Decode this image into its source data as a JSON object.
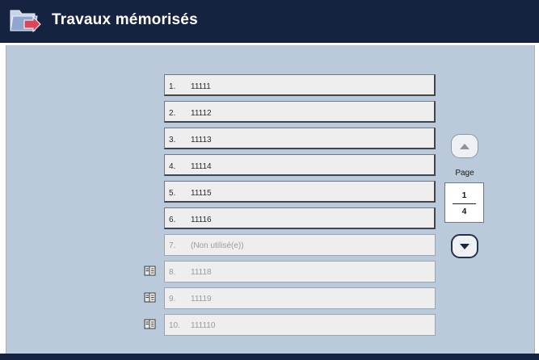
{
  "header": {
    "title": "Travaux mémorisés",
    "icon": "folder-arrow-icon"
  },
  "colors": {
    "header_bg": "#162340",
    "panel_bg": "#bacadb",
    "row_bg": "#eeeeee"
  },
  "jobs": [
    {
      "num": "1.",
      "name": "11111",
      "state": "active"
    },
    {
      "num": "2.",
      "name": "11112",
      "state": "active"
    },
    {
      "num": "3.",
      "name": "11113",
      "state": "active"
    },
    {
      "num": "4.",
      "name": "11114",
      "state": "active"
    },
    {
      "num": "5.",
      "name": "11115",
      "state": "active"
    },
    {
      "num": "6.",
      "name": "11116",
      "state": "active"
    },
    {
      "num": "7.",
      "name": "(Non utilisé(e))",
      "state": "unused"
    },
    {
      "num": "8.",
      "name": "11118",
      "state": "disabled",
      "icon": "document-icon"
    },
    {
      "num": "9.",
      "name": "11119",
      "state": "disabled",
      "icon": "document-icon"
    },
    {
      "num": "10.",
      "name": "111110",
      "state": "disabled",
      "icon": "document-icon"
    }
  ],
  "pagination": {
    "label": "Page",
    "current": "1",
    "total": "4",
    "up_icon": "arrow-up-icon",
    "down_icon": "arrow-down-icon"
  }
}
